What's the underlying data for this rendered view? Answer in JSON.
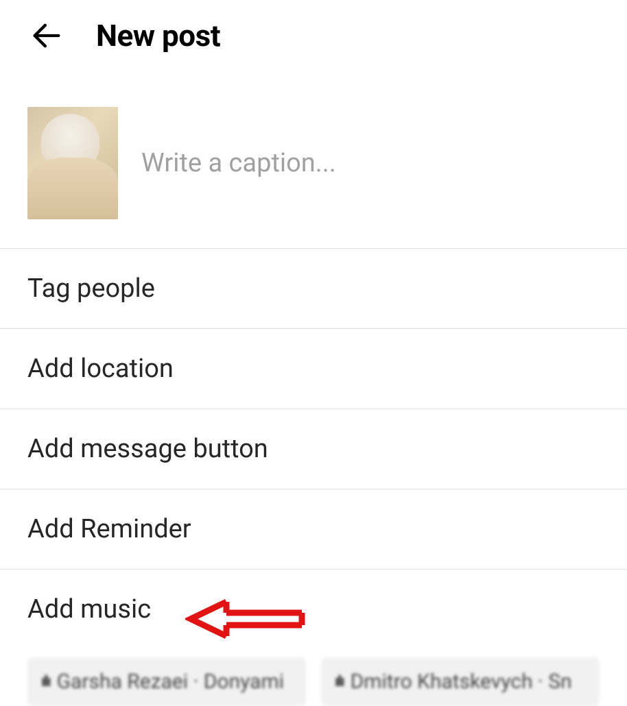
{
  "header": {
    "title": "New post"
  },
  "caption": {
    "placeholder": "Write a caption..."
  },
  "options": {
    "tag_people": "Tag people",
    "add_location": "Add location",
    "add_message_button": "Add message button",
    "add_reminder": "Add Reminder",
    "add_music": "Add music"
  },
  "music_chips": {
    "chip1": "Garsha Rezaei · Donyami",
    "chip2": "Dmitro Khatskevych · Sn"
  }
}
